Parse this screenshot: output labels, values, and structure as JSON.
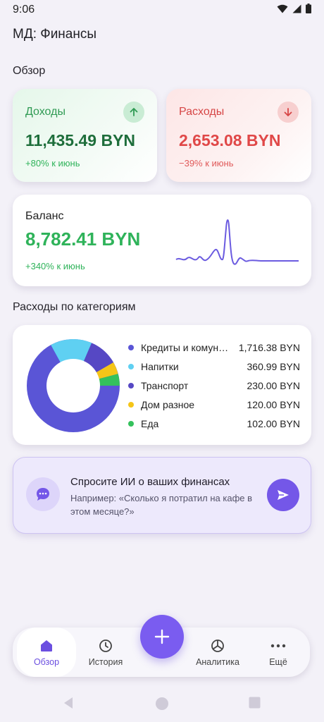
{
  "status": {
    "time": "9:06"
  },
  "app": {
    "title": "МД: Финансы"
  },
  "overview": {
    "section_title": "Обзор",
    "income": {
      "label": "Доходы",
      "amount": "11,435.49 BYN",
      "change": "+80% к июнь",
      "color": "#2f9a53"
    },
    "expenses": {
      "label": "Расходы",
      "amount": "2,653.08 BYN",
      "change": "−39% к июнь",
      "color": "#e04848"
    },
    "balance": {
      "label": "Баланс",
      "amount": "8,782.41 BYN",
      "change": "+340% к июнь",
      "color": "#2fb35a"
    }
  },
  "categories": {
    "section_title": "Расходы по категориям",
    "items": [
      {
        "name": "Кредиты и комун…",
        "value": "1,716.38 BYN",
        "color": "#5a55d6"
      },
      {
        "name": "Напитки",
        "value": "360.99 BYN",
        "color": "#5fd0f2"
      },
      {
        "name": "Транспорт",
        "value": "230.00 BYN",
        "color": "#5648c4"
      },
      {
        "name": "Дом разное",
        "value": "120.00 BYN",
        "color": "#f5c518"
      },
      {
        "name": "Еда",
        "value": "102.00 BYN",
        "color": "#34c15c"
      }
    ]
  },
  "ai": {
    "title": "Спросите ИИ о ваших финансах",
    "hint": "Например: «Сколько я потратил на кафе в этом месяце?»"
  },
  "nav": {
    "items": [
      {
        "label": "Обзор",
        "icon": "home-icon",
        "active": true
      },
      {
        "label": "История",
        "icon": "clock-icon"
      },
      {
        "label": "Аналитика",
        "icon": "pie-chart-icon"
      },
      {
        "label": "Ещё",
        "icon": "more-dots-icon"
      }
    ],
    "fab_icon": "plus-icon"
  }
}
